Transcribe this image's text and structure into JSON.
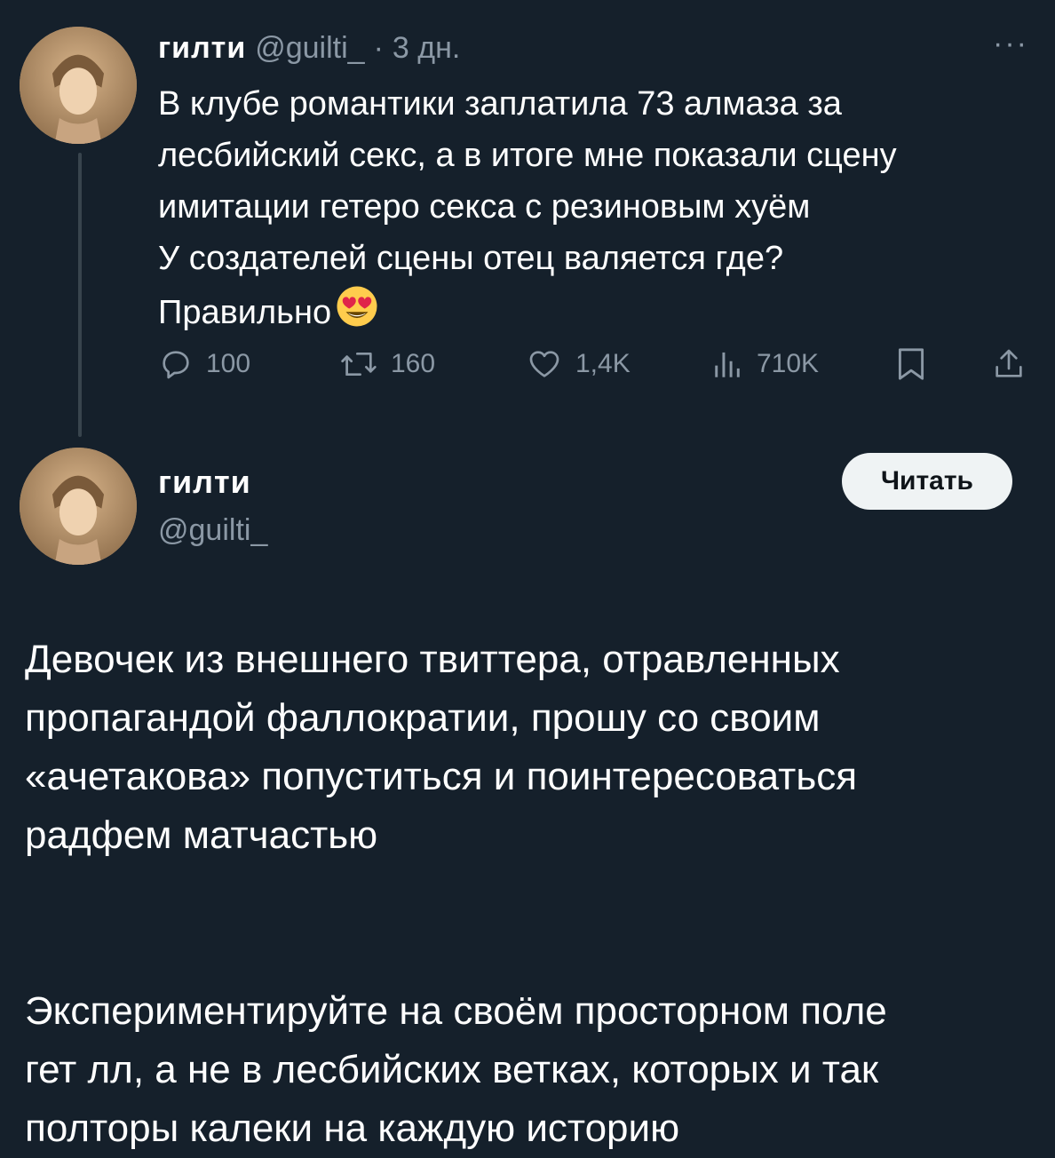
{
  "tweet1": {
    "author_name": "гилти",
    "author_handle": "@guilti_",
    "dot": "·",
    "time": "3 дн.",
    "more": "···",
    "lines": [
      "В клубе романтики заплатила 73 алмаза за",
      "лесбийский секс, а в итоге мне показали сцену",
      "имитации гетеро секса с резиновым хуём",
      "У создателей сцены отец валяется где?",
      "Правильно"
    ],
    "emoji": "heart-eyes-emoji",
    "stats": {
      "replies": "100",
      "retweets": "160",
      "likes": "1,4K",
      "views": "710K"
    }
  },
  "tweet2": {
    "author_name": "гилти",
    "author_handle": "@guilti_",
    "follow_label": "Читать",
    "paragraph1": [
      "Девочек из внешнего твиттера, отравленных",
      "пропагандой фаллократии, прошу со своим",
      "«ачетакова» попуститься и поинтересоваться",
      "радфем матчастью"
    ],
    "paragraph2": [
      "Экспериментируйте на своём просторном поле",
      "гет лл, а не в лесбийских ветках, которых и так",
      "полторы калеки на каждую историю"
    ]
  },
  "colors": {
    "background": "#15202b",
    "text": "#ffffff",
    "muted": "#8b98a5",
    "thread_line": "#38444d",
    "button_bg": "#eff3f4",
    "button_text": "#0f1419"
  }
}
